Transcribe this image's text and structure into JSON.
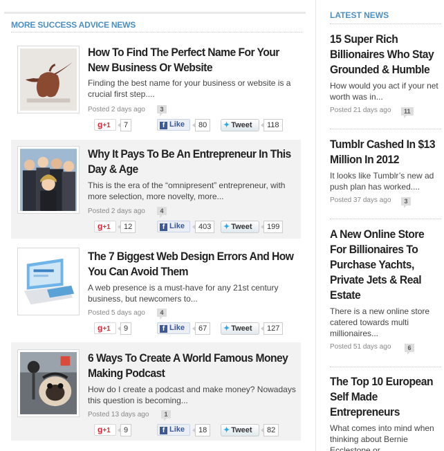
{
  "section": {
    "title": "MORE SUCCESS ADVICE NEWS"
  },
  "articles": [
    {
      "title": "How To Find The Perfect Name For Your New Business Or Website",
      "excerpt": "Finding the best name for your business or website is a crucial first step....",
      "posted": "Posted 2 days ago",
      "comments": "3",
      "gplus_label": "+1",
      "gplus_count": "7",
      "fb_label": "Like",
      "fb_count": "80",
      "tw_label": "Tweet",
      "tw_count": "118",
      "thumb_icon": "apple-nike-logo-image"
    },
    {
      "title": "Why It Pays To Be An Entrepreneur In This Day & Age",
      "excerpt": "This is the era of the “omnipresent” entrepreneur, with more selection, more novelty, more...",
      "posted": "Posted 2 days ago",
      "comments": "4",
      "gplus_label": "+1",
      "gplus_count": "12",
      "fb_label": "Like",
      "fb_count": "403",
      "tw_label": "Tweet",
      "tw_count": "199",
      "thumb_icon": "business-people-image"
    },
    {
      "title": "The 7 Biggest Web Design Errors And How You Can Avoid Them",
      "excerpt": "A web presence is a must-have for any 21st century business, but newcomers to...",
      "posted": "Posted 5 days ago",
      "comments": "4",
      "gplus_label": "+1",
      "gplus_count": "9",
      "fb_label": "Like",
      "fb_count": "67",
      "tw_label": "Tweet",
      "tw_count": "127",
      "thumb_icon": "web-devices-image"
    },
    {
      "title": "6 Ways To Create A World Famous Money Making Podcast",
      "excerpt": "How do I create a podcast and make money? Nowadays this question is becoming...",
      "posted": "Posted 13 days ago",
      "comments": "1",
      "gplus_label": "+1",
      "gplus_count": "9",
      "fb_label": "Like",
      "fb_count": "18",
      "tw_label": "Tweet",
      "tw_count": "82",
      "thumb_icon": "podcast-dog-image"
    }
  ],
  "latest": {
    "title": "LATEST NEWS",
    "items": [
      {
        "title": "15 Super Rich Billionaires Who Stay Grounded & Humble",
        "excerpt": "How would you act if your net worth was in...",
        "posted": "Posted 21 days ago",
        "comments": "11"
      },
      {
        "title": "Tumblr Cashed In $13 Million In 2012",
        "excerpt": "It looks like Tumblr’s new ad push plan has worked....",
        "posted": "Posted 37 days ago",
        "comments": "3"
      },
      {
        "title": "A New Online Store For Billionaires To Purchase Yachts, Private Jets & Real Estate",
        "excerpt": "There is a new online store catered towards multi millionaires...",
        "posted": "Posted 51 days ago",
        "comments": "6"
      },
      {
        "title": "The Top 10 European Self Made Entrepreneurs",
        "excerpt": "What comes into mind when thinking about Bernie Ecclestone or...",
        "posted": "",
        "comments": ""
      }
    ]
  },
  "colors": {
    "accent": "#4a8fc4",
    "alt_row": "#f2f2f2",
    "facebook": "#3b5998",
    "twitter": "#2ea8e5",
    "gplus": "#dd2233"
  }
}
